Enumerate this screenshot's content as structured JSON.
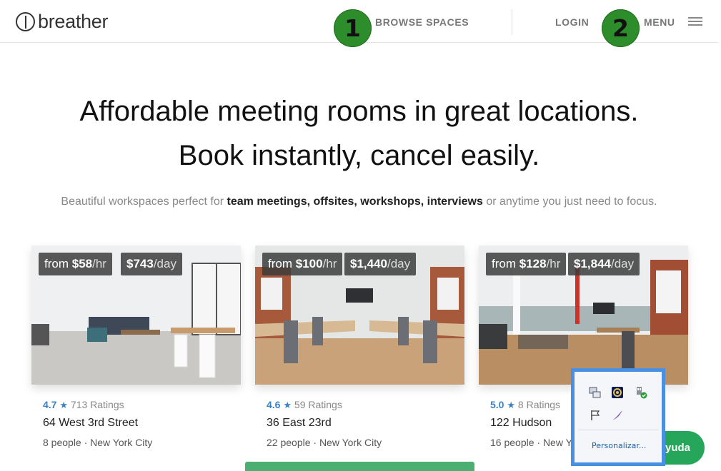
{
  "header": {
    "logo_text": "breather",
    "browse": "BROWSE SPACES",
    "login": "LOGIN",
    "menu": "MENU",
    "badge1": "1",
    "badge2": "2"
  },
  "hero": {
    "line1": "Affordable meeting rooms in great locations.",
    "line2": "Book instantly, cancel easily.",
    "sub_pre": "Beautiful workspaces perfect for",
    "sub_bold": "team meetings, offsites, workshops, interviews",
    "sub_post": "or anytime you just need to focus."
  },
  "cards": [
    {
      "hr_from": "from",
      "hr_price": "$58",
      "hr_unit": "/hr",
      "day_price": "$743",
      "day_unit": "/day",
      "rating": "4.7",
      "star": "★",
      "ratings": "713 Ratings",
      "address": "64 West 3rd Street",
      "meta": "8 people · New York City"
    },
    {
      "hr_from": "from",
      "hr_price": "$100",
      "hr_unit": "/hr",
      "day_price": "$1,440",
      "day_unit": "/day",
      "rating": "4.6",
      "star": "★",
      "ratings": "59 Ratings",
      "address": "36 East 23rd",
      "meta": "22 people · New York City"
    },
    {
      "hr_from": "from",
      "hr_price": "$128",
      "hr_unit": "/hr",
      "day_price": "$1,844",
      "day_unit": "/day",
      "rating": "5.0",
      "star": "★",
      "ratings": "8 Ratings",
      "address": "122 Hudson",
      "meta": "16 people · New Y"
    }
  ],
  "help": {
    "label": "yuda"
  },
  "tray": {
    "link": "Personalizar...",
    "icons": [
      "network-icon",
      "media-icon",
      "usb-safe-remove-icon",
      "action-center-flag-icon",
      "feather-app-icon"
    ]
  },
  "colors": {
    "accent_green": "#26a65b",
    "badge_green": "#2e8d2b",
    "rating_blue": "#3b82c4",
    "tray_border": "#4a90e2"
  }
}
